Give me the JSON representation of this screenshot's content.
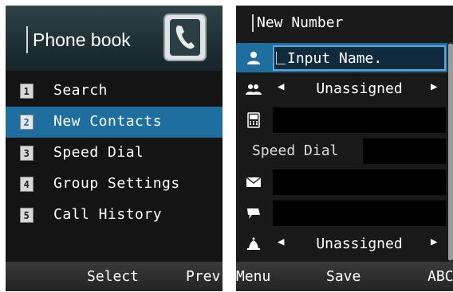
{
  "left_screen": {
    "title": "Phone book",
    "header_icon": "phone-book-icon",
    "menu_items": [
      {
        "number": "1",
        "label": "Search",
        "selected": false
      },
      {
        "number": "2",
        "label": "New Contacts",
        "selected": true
      },
      {
        "number": "3",
        "label": "Speed Dial",
        "selected": false
      },
      {
        "number": "4",
        "label": "Group Settings",
        "selected": false
      },
      {
        "number": "5",
        "label": "Call History",
        "selected": false
      }
    ],
    "softkeys": {
      "center": "Select",
      "right": "Prev"
    }
  },
  "right_screen": {
    "title": "New Number",
    "name_input": {
      "icon": "person-icon",
      "placeholder": "Input Name."
    },
    "group_selector": {
      "icon": "group-icon",
      "value": "Unassigned"
    },
    "mobile_field": {
      "icon": "mobile-phone-icon",
      "value": ""
    },
    "speed_dial": {
      "label": "Speed Dial",
      "value": ""
    },
    "email_field": {
      "icon": "email-icon",
      "value": ""
    },
    "memo_field": {
      "icon": "memo-icon",
      "value": ""
    },
    "ringtone_selector": {
      "icon": "bell-icon",
      "value": "Unassigned"
    },
    "softkeys": {
      "left": "Menu",
      "center": "Save",
      "right": "ABC"
    }
  },
  "colors": {
    "selection_blue": "#1e6fa0",
    "header_teal": "#1f3134",
    "background": "#141414",
    "focus_border": "#5aa6d6"
  }
}
